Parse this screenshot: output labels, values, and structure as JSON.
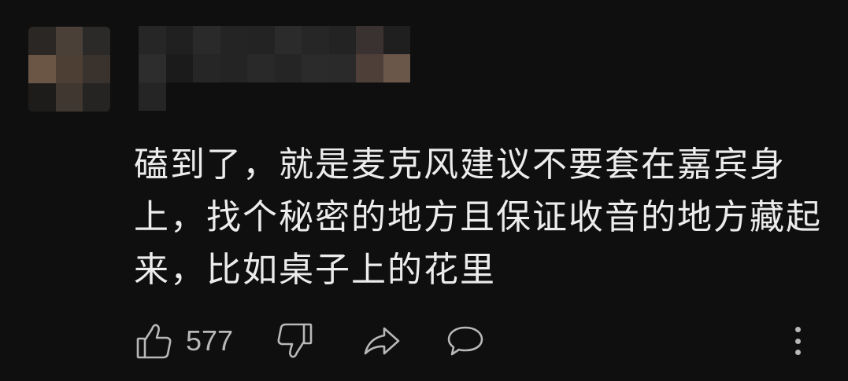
{
  "comment": {
    "lines": [
      "磕到了，就是麦克风建议不要套在嘉宾身",
      "上，找个秘密的地方且保证收音的地方藏起",
      "来，比如桌子上的花里"
    ]
  },
  "actions": {
    "like_count": "577",
    "icons": [
      "thumbs-up-icon",
      "thumbs-down-icon",
      "share-icon",
      "reply-icon",
      "more-vertical-icon"
    ]
  },
  "colors": {
    "background": "#0f0f0f",
    "text": "#ececec",
    "icon": "#b8b8b8"
  }
}
